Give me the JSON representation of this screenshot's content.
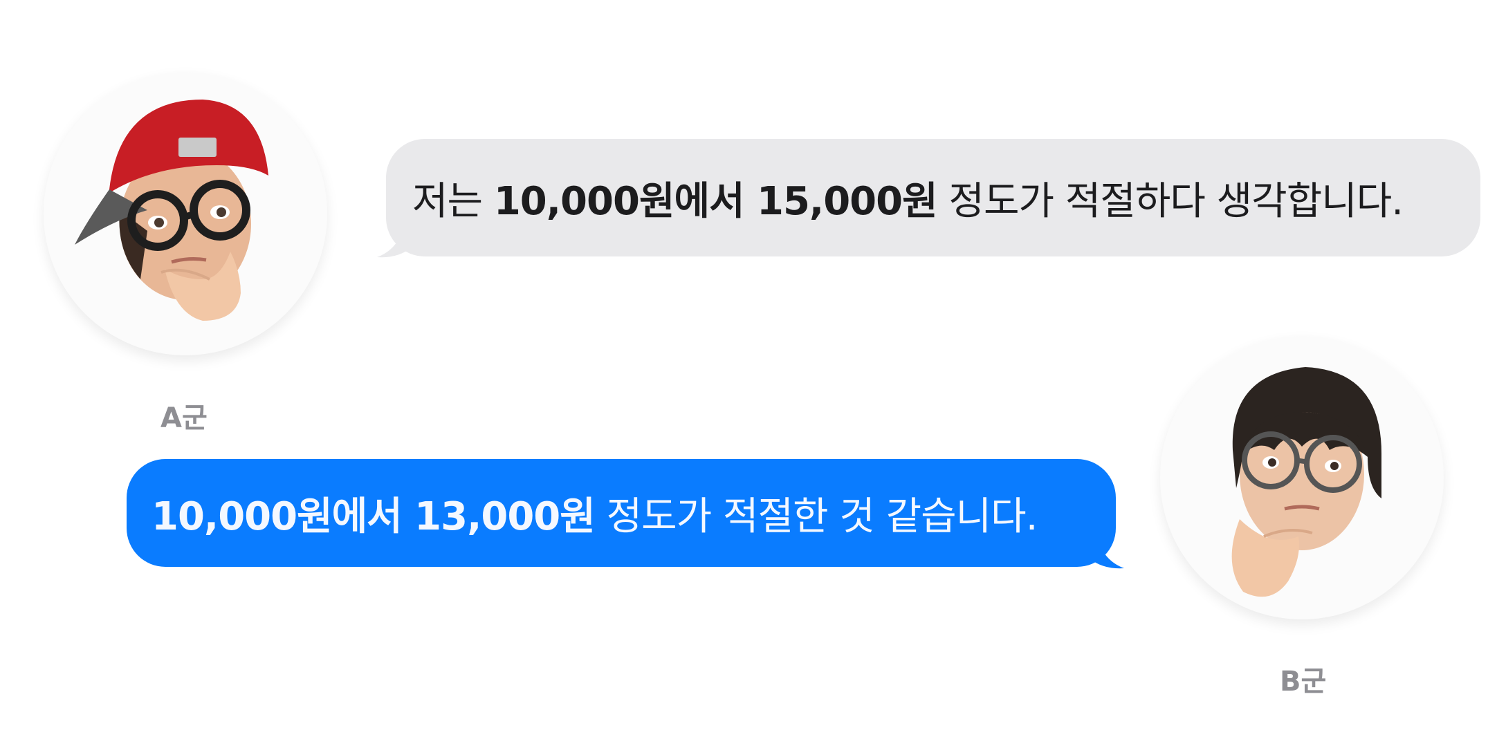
{
  "conversation": {
    "participants": [
      {
        "name": "A군",
        "avatar_icon": "memoji-red-cap-glasses-thinking"
      },
      {
        "name": "B군",
        "avatar_icon": "memoji-bowl-cut-glasses-thinking"
      }
    ],
    "messages": [
      {
        "sender": "A군",
        "side": "incoming",
        "bubble_color": "#e9e9eb",
        "parts": {
          "p1": "저는 ",
          "p2": "10,000원에서 15,000원",
          "p3": " 정도가 적절하다 생각합니다."
        }
      },
      {
        "sender": "B군",
        "side": "outgoing",
        "bubble_color": "#0a7cff",
        "parts": {
          "p1": "10,000원에서 13,000원",
          "p2": " 정도가 적절한 것 같습니다."
        }
      }
    ]
  },
  "colors": {
    "incoming_bubble": "#e9e9eb",
    "outgoing_bubble": "#0a7cff",
    "name_label": "#8e8e93"
  }
}
